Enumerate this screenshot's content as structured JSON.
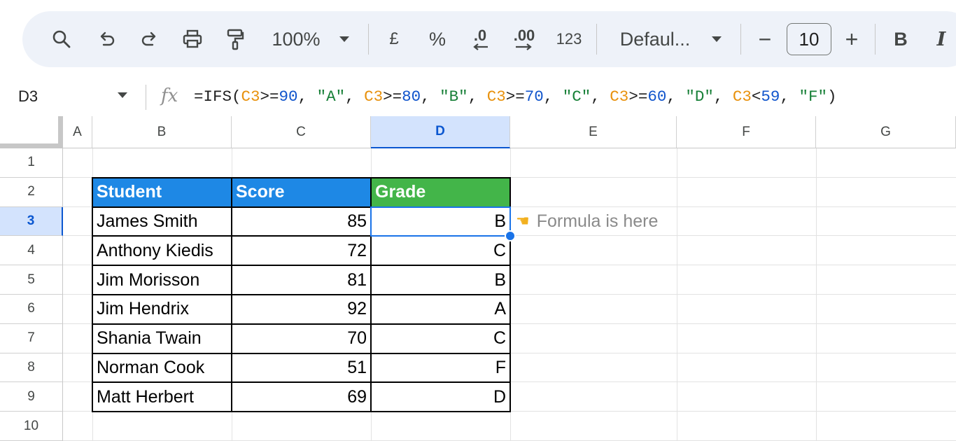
{
  "toolbar": {
    "zoom": "100%",
    "currency": "£",
    "percent": "%",
    "decrease_decimal": ".0",
    "increase_decimal": ".00",
    "number_format": "123",
    "font": "Defaul...",
    "font_size": "10",
    "minus": "−",
    "plus": "+",
    "bold": "B",
    "italic": "I"
  },
  "formula_bar": {
    "cell_ref": "D3",
    "fx": "fx",
    "formula_tokens": [
      {
        "t": "=IFS(",
        "k": "plain"
      },
      {
        "t": "C3",
        "k": "ref"
      },
      {
        "t": ">=",
        "k": "plain"
      },
      {
        "t": "90",
        "k": "num"
      },
      {
        "t": ", ",
        "k": "plain"
      },
      {
        "t": "\"A\"",
        "k": "str"
      },
      {
        "t": ", ",
        "k": "plain"
      },
      {
        "t": "C3",
        "k": "ref"
      },
      {
        "t": ">=",
        "k": "plain"
      },
      {
        "t": "80",
        "k": "num"
      },
      {
        "t": ", ",
        "k": "plain"
      },
      {
        "t": "\"B\"",
        "k": "str"
      },
      {
        "t": ", ",
        "k": "plain"
      },
      {
        "t": "C3",
        "k": "ref"
      },
      {
        "t": ">=",
        "k": "plain"
      },
      {
        "t": "70",
        "k": "num"
      },
      {
        "t": ", ",
        "k": "plain"
      },
      {
        "t": "\"C\"",
        "k": "str"
      },
      {
        "t": ", ",
        "k": "plain"
      },
      {
        "t": "C3",
        "k": "ref"
      },
      {
        "t": ">=",
        "k": "plain"
      },
      {
        "t": "60",
        "k": "num"
      },
      {
        "t": ", ",
        "k": "plain"
      },
      {
        "t": "\"D\"",
        "k": "str"
      },
      {
        "t": ", ",
        "k": "plain"
      },
      {
        "t": "C3",
        "k": "ref"
      },
      {
        "t": "<",
        "k": "plain"
      },
      {
        "t": "59",
        "k": "num"
      },
      {
        "t": ", ",
        "k": "plain"
      },
      {
        "t": "\"F\"",
        "k": "str"
      },
      {
        "t": ")",
        "k": "plain"
      }
    ]
  },
  "sheet": {
    "columns": [
      "A",
      "B",
      "C",
      "D",
      "E",
      "F",
      "G"
    ],
    "selected_column": "D",
    "rows": [
      "1",
      "2",
      "3",
      "4",
      "5",
      "6",
      "7",
      "8",
      "9",
      "10"
    ],
    "selected_row": "3",
    "table": {
      "headers": [
        "Student",
        "Score",
        "Grade"
      ],
      "records": [
        [
          "James Smith",
          "85",
          "B"
        ],
        [
          "Anthony Kiedis",
          "72",
          "C"
        ],
        [
          "Jim Morisson",
          "81",
          "B"
        ],
        [
          "Jim Hendrix",
          "92",
          "A"
        ],
        [
          "Shania Twain",
          "70",
          "C"
        ],
        [
          "Norman Cook",
          "51",
          "F"
        ],
        [
          "Matt Herbert",
          "69",
          "D"
        ]
      ]
    },
    "note": "Formula is here",
    "note_icon": "pointing-hand-icon"
  },
  "colors": {
    "header_blue": "#1e88e5",
    "header_green": "#43b549",
    "selection": "#1a73e8",
    "ref_orange": "#e8910c",
    "num_blue": "#1155cc",
    "str_green": "#188038"
  }
}
